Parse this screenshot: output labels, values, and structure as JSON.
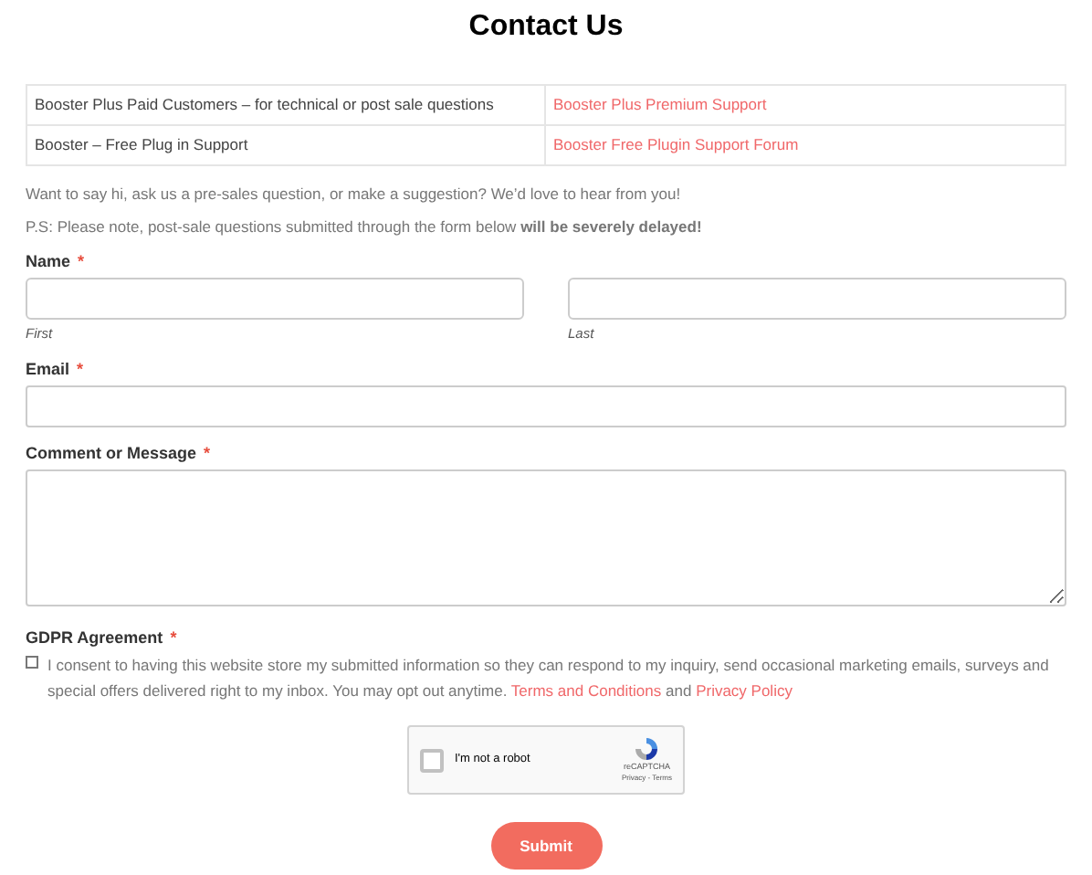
{
  "title": "Contact Us",
  "support_table": {
    "rows": [
      {
        "audience": "Booster Plus Paid Customers – for technical or post sale questions",
        "link": "Booster Plus Premium Support"
      },
      {
        "audience": "Booster – Free Plug in Support",
        "link": "Booster Free Plugin Support Forum"
      }
    ]
  },
  "intro": "Want to say hi, ask us a pre-sales question, or make a suggestion? We’d love to hear from you!",
  "note": "P.S: Please note, post-sale questions submitted through the form below **will be severely delayed!**",
  "form": {
    "name": {
      "label": "Name",
      "required": "*",
      "first_hint": "First",
      "last_hint": "Last"
    },
    "email": {
      "label": "Email",
      "required": "*"
    },
    "message": {
      "label": "Comment or Message",
      "required": "*"
    },
    "gdpr": {
      "label": "GDPR Agreement",
      "required": "*",
      "checked": false,
      "text": "I consent to having this website store my submitted information so they can respond to my inquiry, send occasional marketing emails, surveys and special offers delivered right to my inbox. You may opt out anytime.",
      "terms_link": "Terms and Conditions",
      "joiner": "and",
      "privacy_link": "Privacy Policy"
    },
    "captcha": {
      "label": "I'm not a robot",
      "checked": false,
      "brand": "reCAPTCHA",
      "footer": "Privacy - Terms"
    },
    "submit": "Submit"
  }
}
